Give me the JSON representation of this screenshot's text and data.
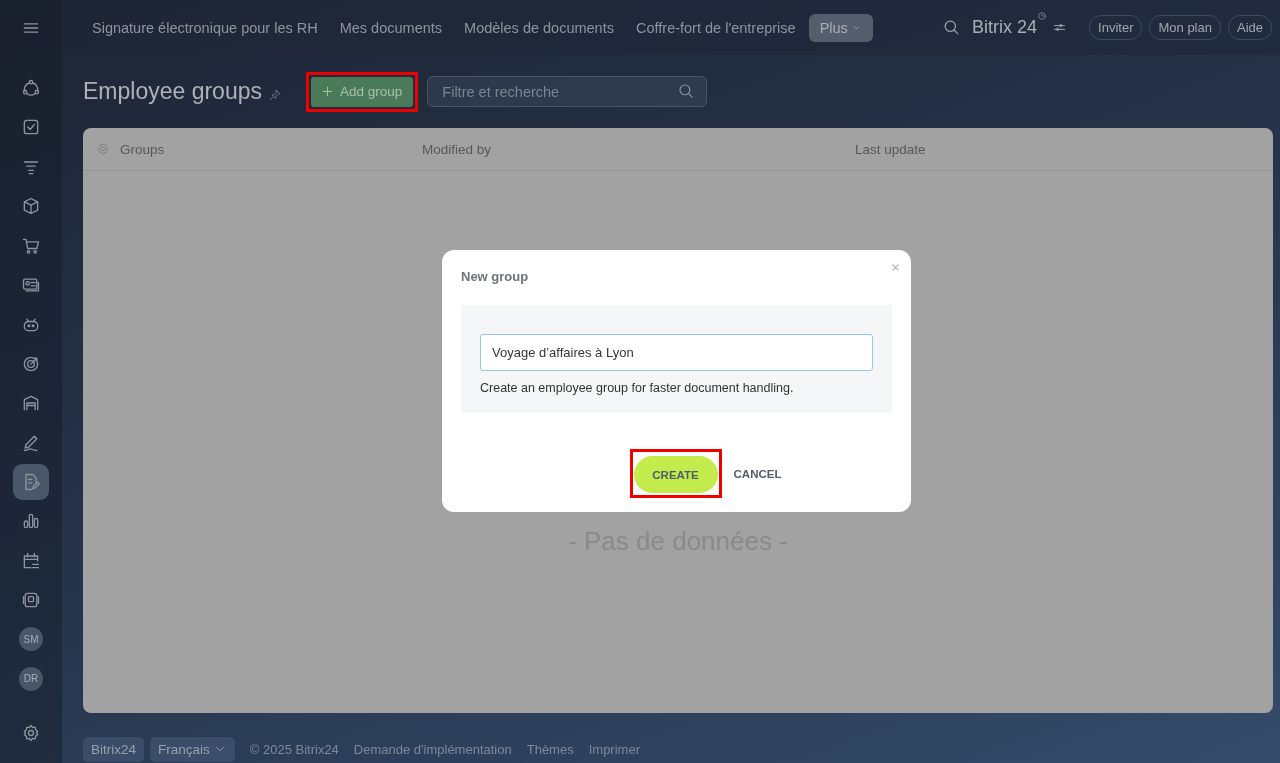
{
  "top_nav": {
    "tabs": [
      {
        "label": "Signature électronique pour les RH",
        "selected": false
      },
      {
        "label": "Mes documents",
        "selected": false
      },
      {
        "label": "Modèles de documents",
        "selected": false
      },
      {
        "label": "Coffre-fort de l'entreprise",
        "selected": false
      },
      {
        "label": "Plus",
        "selected": true
      }
    ],
    "logo": "Bitrix 24",
    "buttons": [
      "Inviter",
      "Mon plan",
      "Aide"
    ]
  },
  "sidebar": {
    "items": [
      {
        "kind": "icon",
        "selected": false
      },
      {
        "kind": "icon",
        "selected": false
      },
      {
        "kind": "icon",
        "selected": false
      },
      {
        "kind": "icon",
        "selected": false
      },
      {
        "kind": "icon",
        "selected": false
      },
      {
        "kind": "icon",
        "selected": false
      },
      {
        "kind": "icon",
        "selected": false
      },
      {
        "kind": "icon",
        "selected": false
      },
      {
        "kind": "icon",
        "selected": false
      },
      {
        "kind": "icon",
        "selected": false
      },
      {
        "kind": "icon",
        "selected": true
      },
      {
        "kind": "icon",
        "selected": false
      },
      {
        "kind": "icon",
        "selected": false
      },
      {
        "kind": "icon",
        "selected": false
      },
      {
        "kind": "avatar",
        "label": "SM",
        "selected": false
      },
      {
        "kind": "avatar",
        "label": "DR",
        "selected": false
      }
    ]
  },
  "page": {
    "title": "Employee groups",
    "add_button": "Add group",
    "search": {
      "placeholder": "Filtre et recherche"
    }
  },
  "table": {
    "columns": [
      "Groups",
      "Modified by",
      "Last update"
    ],
    "empty_text": "- Pas de données -"
  },
  "footer": {
    "brand": "Bitrix24",
    "language": "Français",
    "links": [
      "© 2025 Bitrix24",
      "Demande d'implémentation",
      "Thèmes",
      "Imprimer"
    ]
  },
  "dialog": {
    "title": "New group",
    "name_field": {
      "value": "Voyage d’affaires à Lyon"
    },
    "hint": "Create an employee group for faster document handling.",
    "buttons": [
      {
        "label": "CREATE",
        "kind": "primary"
      },
      {
        "label": "CANCEL",
        "kind": "link"
      }
    ]
  }
}
